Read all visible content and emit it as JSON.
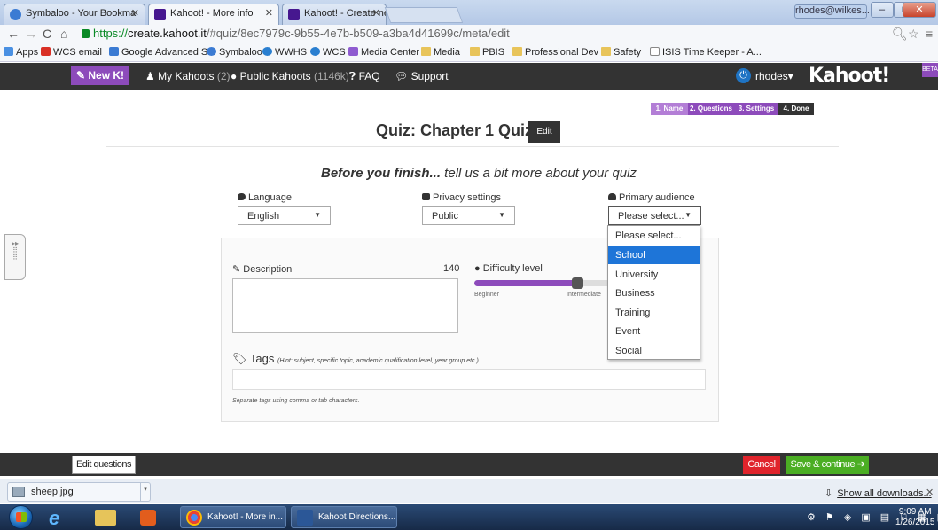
{
  "browser": {
    "tabs": [
      {
        "title": "Symbaloo - Your Bookma",
        "favicon_color": "#3b7bd3"
      },
      {
        "title": "Kahoot! - More info",
        "favicon_color": "#46178f"
      },
      {
        "title": "Kahoot! - Create new Kah",
        "favicon_color": "#46178f"
      }
    ],
    "window_user": "rhodes@wilkes...",
    "url": {
      "scheme": "https://",
      "host": "create.kahoot.it",
      "path": "/#quiz/8ec7979c-9b55-4e7b-b509-a3ba4d41699c/meta/edit"
    },
    "bookmarks": [
      "Apps",
      "WCS email",
      "Google Advanced S...",
      "Symbaloo",
      "WWHS",
      "WCS",
      "Media Center",
      "Media",
      "PBIS",
      "Professional Dev",
      "Safety",
      "ISIS Time Keeper - A..."
    ]
  },
  "kahoot_nav": {
    "new_button": "New K!",
    "my_kahoots": "My Kahoots",
    "my_kahoots_count": "(2)",
    "public_kahoots": "Public Kahoots",
    "public_kahoots_count": "(1146k)",
    "faq": "FAQ",
    "support": "Support",
    "user": "rhodes",
    "logo": "Kahoot!",
    "beta": "BETA"
  },
  "steps": [
    {
      "label": "1. Name",
      "color": "#b37ed6"
    },
    {
      "label": "2. Questions",
      "color": "#8d4bbb"
    },
    {
      "label": "3. Settings",
      "color": "#8d4bbb"
    },
    {
      "label": "4. Done",
      "color": "#333333"
    }
  ],
  "page": {
    "title": "Quiz: Chapter 1 Quiz",
    "edit_label": "Edit",
    "finish_bold": "Before you finish...",
    "finish_rest": " tell us a bit more about your quiz"
  },
  "form": {
    "language_label": "Language",
    "language_value": "English",
    "privacy_label": "Privacy settings",
    "privacy_value": "Public",
    "audience_label": "Primary audience",
    "audience_value": "Please select...",
    "audience_options": [
      "Please select...",
      "School",
      "University",
      "Business",
      "Training",
      "Event",
      "Social"
    ],
    "audience_highlighted": "School",
    "description_label": "Description",
    "description_count": "140",
    "difficulty_label": "Difficulty level",
    "difficulty_value": 0.55,
    "difficulty_scale": [
      "Beginner",
      "Intermediate"
    ],
    "tags_label": "Tags",
    "tags_hint": "(Hint: subject, specific topic, academic qualification level, year group etc.)",
    "tags_note": "Separate tags using comma or tab characters."
  },
  "footer": {
    "edit_questions": "Edit questions",
    "cancel": "Cancel",
    "save": "Save & continue"
  },
  "downloads": {
    "file": "sheep.jpg",
    "show_all": "Show all downloads..."
  },
  "taskbar": {
    "tasks": [
      "Kahoot! - More in...",
      "Kahoot Directions..."
    ],
    "time": "9:09 AM",
    "date": "1/26/2015"
  }
}
